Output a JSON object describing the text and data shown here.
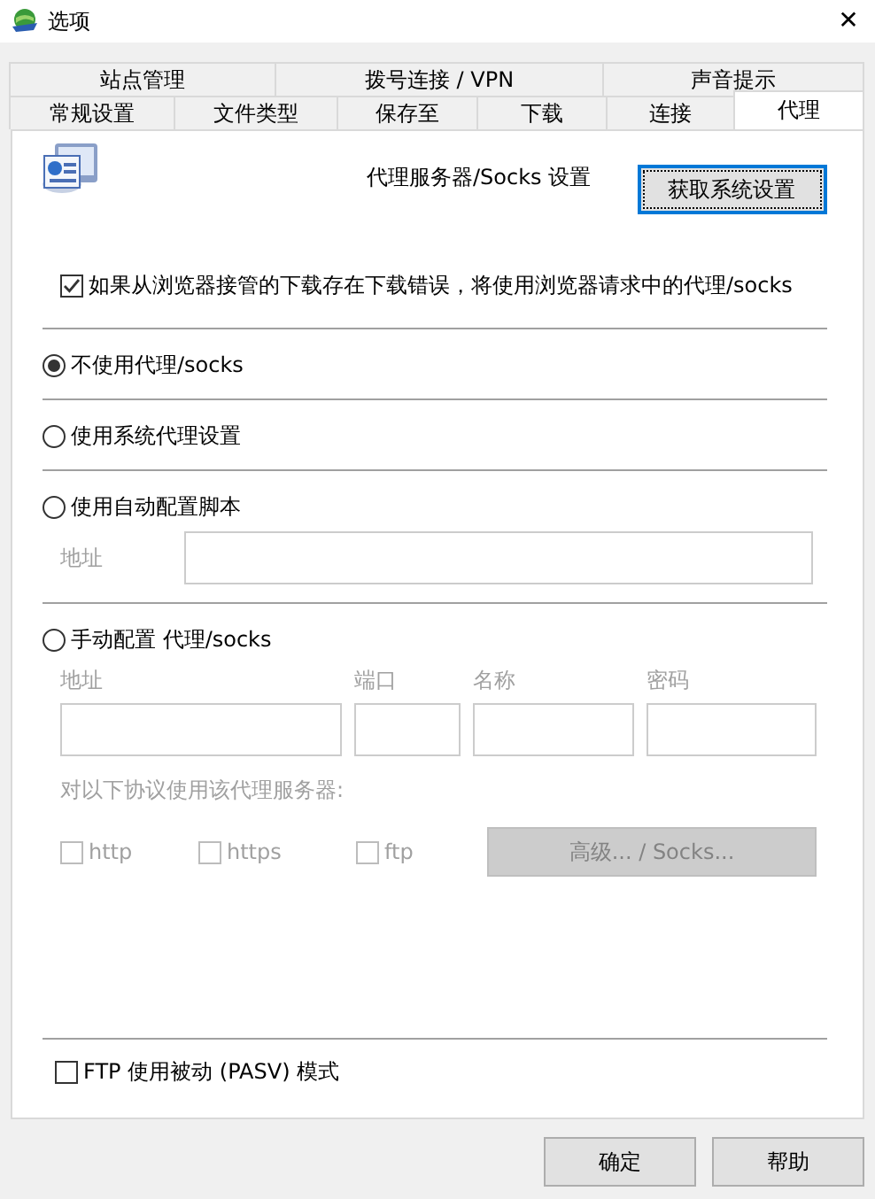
{
  "window": {
    "title": "选项",
    "close": "✕"
  },
  "tab_rows": [
    [
      {
        "label": "站点管理",
        "selected": false
      },
      {
        "label": "拨号连接 / VPN",
        "selected": false
      },
      {
        "label": "声音提示",
        "selected": false
      }
    ],
    [
      {
        "label": "常规设置",
        "selected": false
      },
      {
        "label": "文件类型",
        "selected": false
      },
      {
        "label": "保存至",
        "selected": false
      },
      {
        "label": "下载",
        "selected": false
      },
      {
        "label": "连接",
        "selected": false
      },
      {
        "label": "代理",
        "selected": true
      }
    ]
  ],
  "header": {
    "title": "代理服务器/Socks 设置",
    "button": "获取系统设置"
  },
  "browser_proxy": {
    "label": "如果从浏览器接管的下载存在下载错误，将使用浏览器请求中的代理/socks",
    "checked": true
  },
  "modes": [
    {
      "label": "不使用代理/socks",
      "selected": true
    },
    {
      "label": "使用系统代理设置",
      "selected": false
    },
    {
      "label": "使用自动配置脚本",
      "selected": false,
      "fields": [
        {
          "label": "地址",
          "disabled": true
        }
      ]
    },
    {
      "label": "手动配置 代理/socks",
      "selected": false,
      "manual": {
        "disabled": true,
        "fields": [
          {
            "label": "地址"
          },
          {
            "label": "端口"
          },
          {
            "label": "名称"
          },
          {
            "label": "密码"
          }
        ],
        "protocol_label": "对以下协议使用该代理服务器:",
        "protocols": [
          {
            "label": "http",
            "checked": false
          },
          {
            "label": "https",
            "checked": false
          },
          {
            "label": "ftp",
            "checked": false
          }
        ],
        "advanced_button": "高级... / Socks..."
      }
    }
  ],
  "ftp_pasv": {
    "label": "FTP 使用被动 (PASV) 模式",
    "checked": false
  },
  "buttons": [
    "确定",
    "帮助"
  ]
}
